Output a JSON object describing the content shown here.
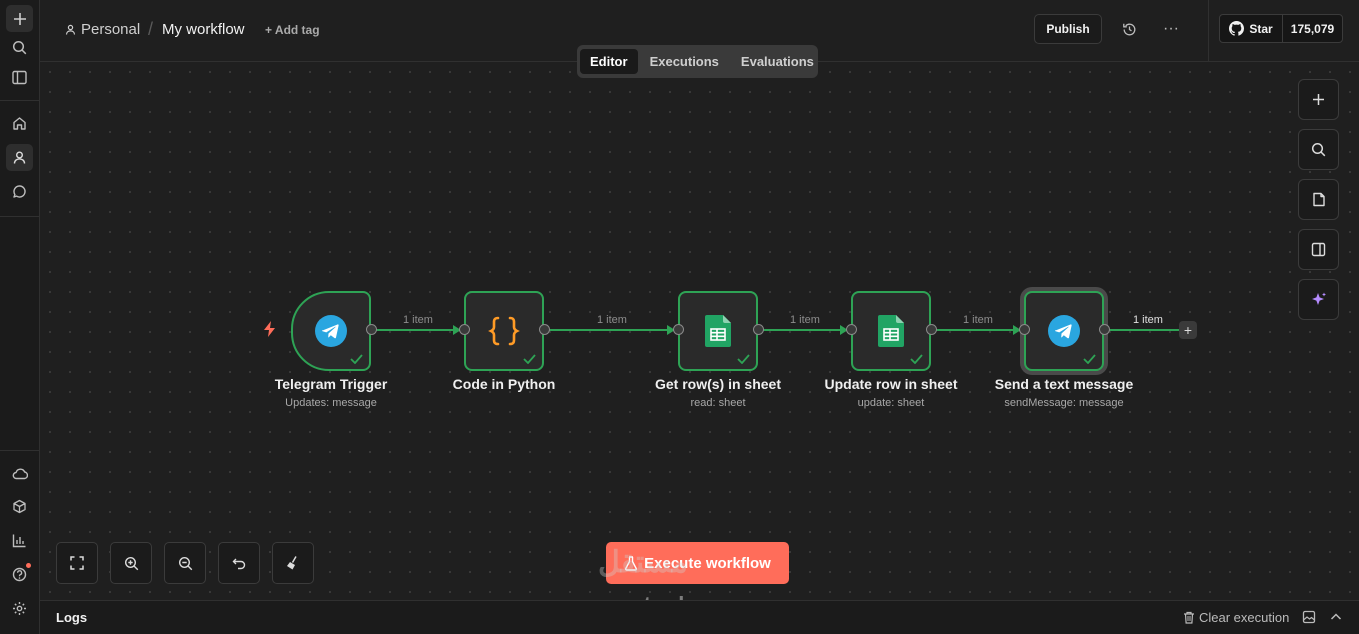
{
  "breadcrumb": {
    "project": "Personal",
    "workflow_name": "My workflow",
    "add_tag": "+ Add tag"
  },
  "header": {
    "publish": "Publish",
    "github_star": "Star",
    "github_count": "175,079"
  },
  "tabs": [
    {
      "label": "Editor",
      "active": true
    },
    {
      "label": "Executions",
      "active": false
    },
    {
      "label": "Evaluations",
      "active": false
    }
  ],
  "nodes": [
    {
      "name": "Telegram Trigger",
      "subtitle": "Updates: message",
      "icon": "telegram-icon"
    },
    {
      "name": "Code in Python",
      "subtitle": "",
      "icon": "code-braces-icon"
    },
    {
      "name": "Get row(s) in sheet",
      "subtitle": "read: sheet",
      "icon": "google-sheets-icon"
    },
    {
      "name": "Update row in sheet",
      "subtitle": "update: sheet",
      "icon": "google-sheets-icon"
    },
    {
      "name": "Send a text message",
      "subtitle": "sendMessage: message",
      "icon": "telegram-icon"
    }
  ],
  "edges": [
    {
      "label": "1 item"
    },
    {
      "label": "1 item"
    },
    {
      "label": "1 item"
    },
    {
      "label": "1 item"
    },
    {
      "label": "1 item"
    }
  ],
  "actions": {
    "execute": "Execute workflow"
  },
  "watermark": {
    "logo": "مستقل",
    "text": "mostaql.com"
  },
  "logs": {
    "title": "Logs",
    "clear": "Clear execution"
  },
  "colors": {
    "accent": "#ff6d5a",
    "success": "#2ea355",
    "telegram": "#2aa6e0",
    "sheets": "#21a464",
    "code": "#ff9b26"
  }
}
